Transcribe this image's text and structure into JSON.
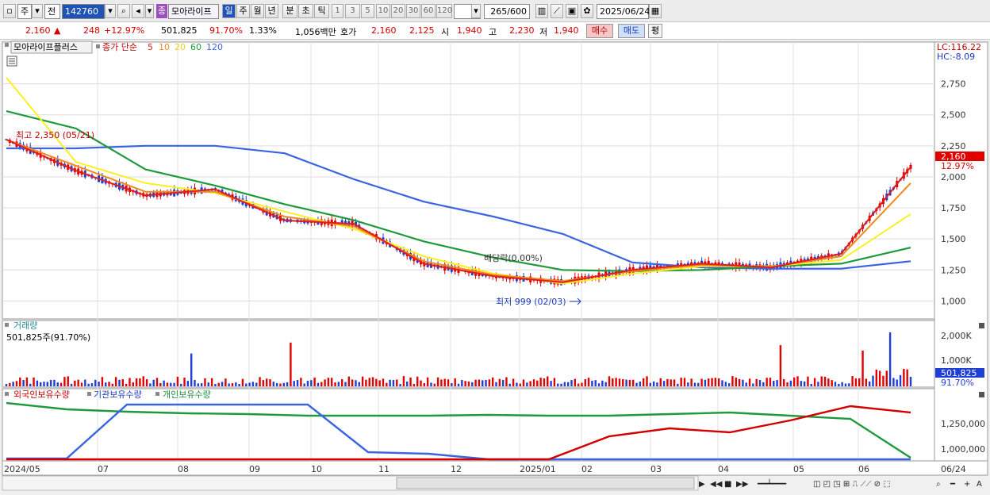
{
  "toolbar": {
    "market": "주",
    "scope": "전",
    "code": "142760",
    "stock_name": "모아라이프",
    "name_badge": "종",
    "periods": [
      "일",
      "주",
      "월",
      "년",
      "분",
      "초",
      "틱"
    ],
    "selected_period": "일",
    "intervals": [
      "1",
      "3",
      "5",
      "10",
      "20",
      "30",
      "60",
      "120"
    ],
    "count": "265",
    "count_total": "/600",
    "date": "2025/06/24"
  },
  "quote": {
    "price": "2,160",
    "up_arrow": "▲",
    "change": "248",
    "change_pct": "+12.97%",
    "volume": "501,825",
    "vol_ratio": "91.70%",
    "turnover": "1.33%",
    "amount": "1,056백만",
    "hoga_label": "호가",
    "ask": "2,160",
    "bid": "2,125",
    "open_label": "시",
    "open": "1,940",
    "high_label": "고",
    "high": "2,230",
    "low_label": "저",
    "low": "1,940",
    "buy_label": "매수",
    "sell_label": "매도",
    "eval_label": "평"
  },
  "legend": {
    "title": "모아라이프플러스",
    "ma_label": "종가 단순",
    "ma_periods": [
      "5",
      "10",
      "20",
      "60",
      "120"
    ]
  },
  "annotations": {
    "high_label": "최고 2,350 (05/21)",
    "low_label": "최저 999 (02/03)",
    "dividend": "배당락(0.00%)",
    "lc": "LC:116.22",
    "hc": "HC:-8.09",
    "price_tag": "2,160",
    "pct_tag": "12.97%"
  },
  "volume_panel": {
    "title": "거래량",
    "sub": "501,825주(91.70%)",
    "tag_value": "501,825",
    "tag_pct": "91.70%",
    "axis": [
      "2,000K",
      "1,000K"
    ]
  },
  "holdings_panel": {
    "titles": [
      "외국인보유수량",
      "기관보유수량",
      "개인보유수량"
    ],
    "axis": [
      "1,250,000",
      "1,000,000"
    ]
  },
  "x_axis": [
    "2024/05",
    "07",
    "08",
    "09",
    "10",
    "11",
    "12",
    "2025/01",
    "02",
    "03",
    "04",
    "05",
    "06",
    "06/24"
  ],
  "colors": {
    "up": "#e00000",
    "down": "#1e3ed6",
    "ma5": "#e01e1e",
    "ma10": "#f08a1c",
    "ma20": "#ffee22",
    "ma60": "#1e9a3c",
    "ma120": "#3b64e0"
  },
  "chart_data": {
    "type": "line",
    "x": [
      "2024/05",
      "07",
      "08",
      "09",
      "10",
      "11",
      "12",
      "2025/01",
      "02",
      "03",
      "04",
      "05",
      "06",
      "06/24"
    ],
    "y_ticks": [
      "2,750",
      "2,500",
      "2,250",
      "2,000",
      "1,750",
      "1,500",
      "1,250",
      "1,000"
    ],
    "ylim": [
      900,
      2850
    ],
    "series": [
      {
        "name": "5",
        "values": [
          2300,
          2050,
          1850,
          1900,
          1650,
          1620,
          1300,
          1200,
          1150,
          1250,
          1300,
          1270,
          1380,
          2080
        ]
      },
      {
        "name": "10",
        "values": [
          2300,
          2090,
          1880,
          1880,
          1680,
          1600,
          1320,
          1210,
          1160,
          1240,
          1290,
          1275,
          1360,
          1950
        ]
      },
      {
        "name": "20",
        "values": [
          2800,
          2120,
          1950,
          1870,
          1720,
          1580,
          1360,
          1220,
          1140,
          1220,
          1280,
          1280,
          1330,
          1700
        ]
      },
      {
        "name": "60",
        "values": [
          2530,
          2390,
          2060,
          1930,
          1780,
          1650,
          1480,
          1350,
          1250,
          1240,
          1250,
          1280,
          1300,
          1430
        ]
      },
      {
        "name": "120",
        "values": [
          2230,
          2230,
          2250,
          2250,
          2190,
          1980,
          1800,
          1680,
          1540,
          1310,
          1270,
          1260,
          1260,
          1320
        ]
      }
    ]
  }
}
